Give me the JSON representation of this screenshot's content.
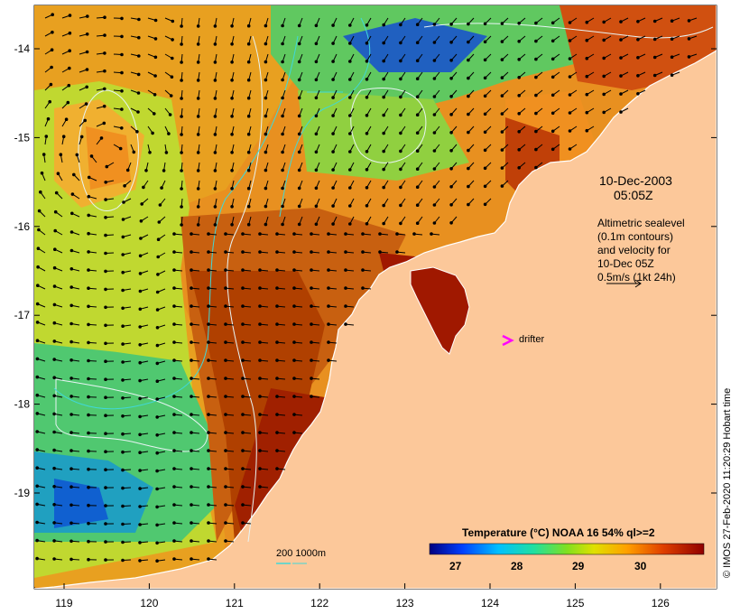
{
  "map": {
    "date_label": "10-Dec-2003",
    "time_label": "05:05Z",
    "legend_lines": [
      "Altimetric sealevel",
      "(0.1m contours)",
      "and velocity for",
      "10-Dec 05Z",
      "0.5m/s (1kt 24h)"
    ],
    "drifter_label": "drifter",
    "depth_label": "200  1000m",
    "credit": "© IMOS 27-Feb-2020 11:20:29 Hobart time",
    "colorbar_title": "Temperature (°C) NOAA 16 54% ql>=2",
    "colorbar_ticks": [
      "27",
      "28",
      "29",
      "30"
    ],
    "x_ticks": [
      "119",
      "120",
      "121",
      "122",
      "123",
      "124",
      "125",
      "126"
    ],
    "y_ticks": [
      "-14",
      "-15",
      "-16",
      "-17",
      "-18",
      "-19"
    ],
    "colors": {
      "land": "#fcc89a",
      "contour": "#e8f4f4",
      "isobath": "#40d8d8",
      "drifter": "#ff00ff",
      "arrow": "#000000"
    }
  }
}
